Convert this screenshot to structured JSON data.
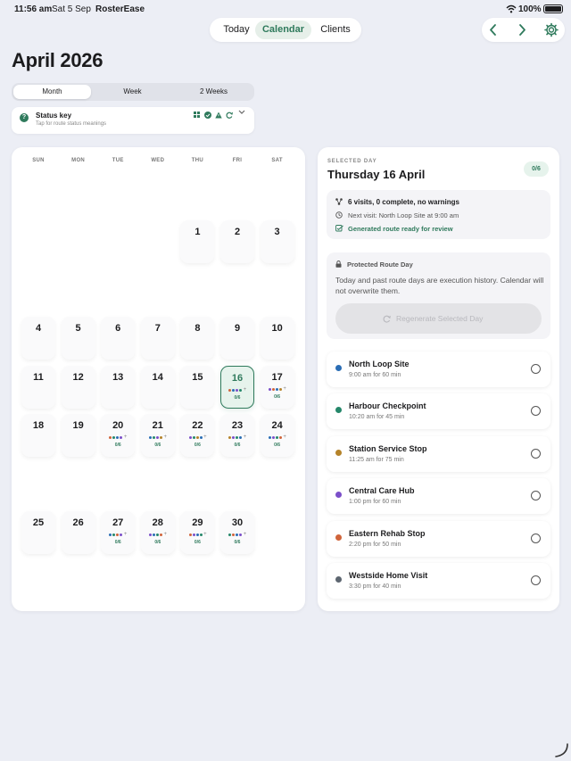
{
  "status_bar": {
    "time": "11:56 am",
    "date": "Sat 5 Sep",
    "app": "RosterEase",
    "battery": "100%"
  },
  "top_tabs": [
    "Today",
    "Calendar",
    "Clients"
  ],
  "active_tab": 1,
  "page_title": "April 2026",
  "view_tabs": [
    "Month",
    "Week",
    "2 Weeks"
  ],
  "status_key": {
    "title": "Status key",
    "subtitle": "Tap for route status meanings"
  },
  "weekdays": [
    "SUN",
    "MON",
    "TUE",
    "WED",
    "THU",
    "FRI",
    "SAT"
  ],
  "colors": {
    "green": "#2f7a5c",
    "blue": "#2a6db5",
    "teal": "#25876a",
    "amber": "#b5832a",
    "purple": "#7b4fc9",
    "orange": "#d0643a",
    "slate": "#5d6670"
  },
  "calendar_days": [
    {
      "d": "1"
    },
    {
      "d": "2"
    },
    {
      "d": "3"
    },
    {
      "d": "4"
    },
    {
      "d": "5"
    },
    {
      "d": "6"
    },
    {
      "d": "7"
    },
    {
      "d": "8"
    },
    {
      "d": "9"
    },
    {
      "d": "10"
    },
    {
      "d": "11"
    },
    {
      "d": "12"
    },
    {
      "d": "13"
    },
    {
      "d": "14"
    },
    {
      "d": "15"
    },
    {
      "d": "16",
      "dots": [
        "orange",
        "blue",
        "purple",
        "teal"
      ],
      "count": "0/6",
      "selected": true
    },
    {
      "d": "17",
      "dots": [
        "purple",
        "orange",
        "blue",
        "amber"
      ],
      "count": "0/6"
    },
    {
      "d": "18"
    },
    {
      "d": "19"
    },
    {
      "d": "20",
      "dots": [
        "orange",
        "teal",
        "blue",
        "purple"
      ],
      "count": "0/6"
    },
    {
      "d": "21",
      "dots": [
        "blue",
        "teal",
        "purple",
        "amber"
      ],
      "count": "0/6"
    },
    {
      "d": "22",
      "dots": [
        "purple",
        "teal",
        "amber",
        "blue"
      ],
      "count": "0/6"
    },
    {
      "d": "23",
      "dots": [
        "amber",
        "purple",
        "teal",
        "blue"
      ],
      "count": "0/6"
    },
    {
      "d": "24",
      "dots": [
        "blue",
        "purple",
        "teal",
        "orange"
      ],
      "count": "0/6"
    },
    {
      "d": "25"
    },
    {
      "d": "26"
    },
    {
      "d": "27",
      "dots": [
        "blue",
        "teal",
        "orange",
        "purple"
      ],
      "count": "0/6"
    },
    {
      "d": "28",
      "dots": [
        "purple",
        "blue",
        "teal",
        "orange"
      ],
      "count": "0/6"
    },
    {
      "d": "29",
      "dots": [
        "orange",
        "purple",
        "blue",
        "teal"
      ],
      "count": "0/6"
    },
    {
      "d": "30",
      "dots": [
        "teal",
        "orange",
        "blue",
        "purple"
      ],
      "count": "0/6"
    }
  ],
  "selected_day": {
    "label": "SELECTED DAY",
    "title": "Thursday 16 April",
    "progress": "0/6",
    "summary": "6 visits, 0 complete, no warnings",
    "next_visit": "Next visit: North Loop Site at 9:00 am",
    "route_ready": "Generated route ready for review",
    "protected_title": "Protected Route Day",
    "protected_text": "Today and past route days are execution history. Calendar will not overwrite them.",
    "regenerate_label": "Regenerate Selected Day"
  },
  "visits": [
    {
      "name": "North Loop Site",
      "time": "9:00 am for 60 min",
      "color": "blue"
    },
    {
      "name": "Harbour Checkpoint",
      "time": "10:20 am for 45 min",
      "color": "teal"
    },
    {
      "name": "Station Service Stop",
      "time": "11:25 am for 75 min",
      "color": "amber"
    },
    {
      "name": "Central Care Hub",
      "time": "1:00 pm for 60 min",
      "color": "purple"
    },
    {
      "name": "Eastern Rehab Stop",
      "time": "2:20 pm for 50 min",
      "color": "orange"
    },
    {
      "name": "Westside Home Visit",
      "time": "3:30 pm for 40 min",
      "color": "slate"
    }
  ]
}
